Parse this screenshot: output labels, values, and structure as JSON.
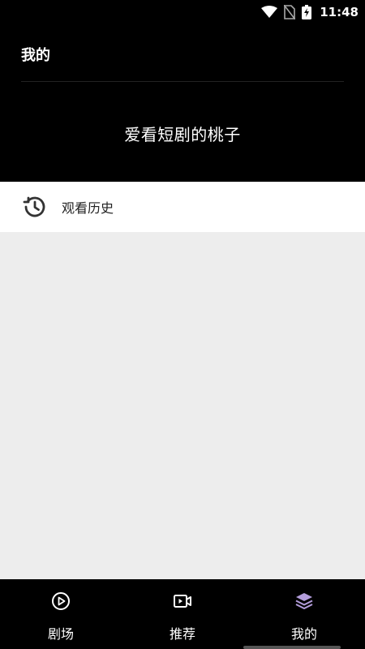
{
  "status_bar": {
    "time": "11:48",
    "icons": [
      "wifi-icon",
      "no-sim-icon",
      "battery-charging-icon"
    ]
  },
  "header": {
    "title": "我的",
    "username": "爱看短剧的桃子"
  },
  "menu": {
    "history": {
      "label": "观看历史",
      "icon": "history-icon"
    }
  },
  "bottom_nav": {
    "items": [
      {
        "label": "剧场",
        "icon": "play-circle-icon",
        "active": false
      },
      {
        "label": "推荐",
        "icon": "video-camera-icon",
        "active": false
      },
      {
        "label": "我的",
        "icon": "layers-icon",
        "active": true
      }
    ]
  },
  "colors": {
    "background": "#ededed",
    "header_bg": "#000000",
    "active_icon": "#b39ddb"
  }
}
